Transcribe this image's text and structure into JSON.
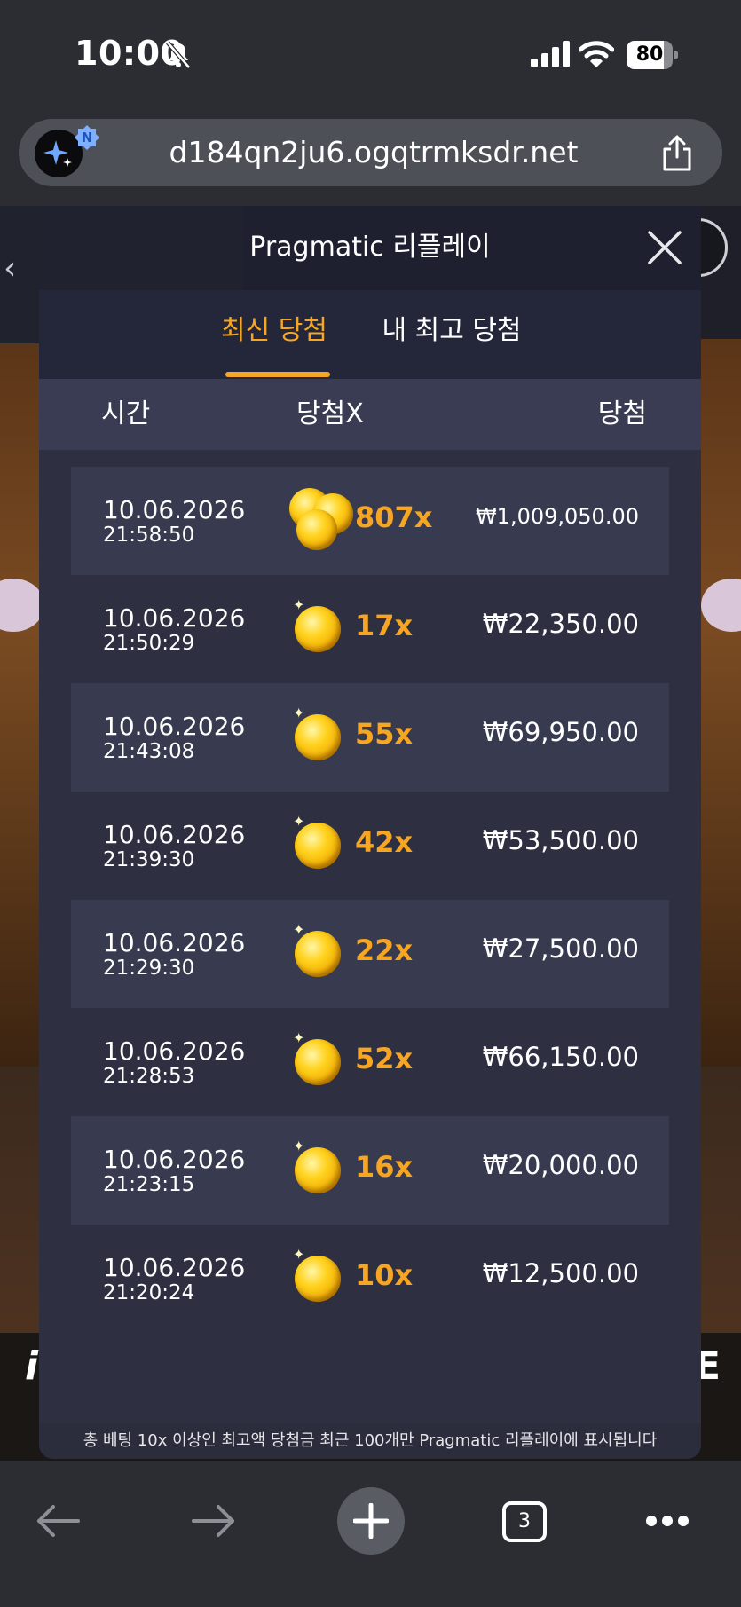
{
  "status_bar": {
    "time": "10:00",
    "battery_level": "80",
    "icons": [
      "bell-slash-icon",
      "cellular-signal-icon",
      "wifi-icon",
      "battery-icon"
    ]
  },
  "browser": {
    "url": "d184qn2ju6.ogqtrmksdr.net",
    "ai_badge": "N",
    "open_tabs": "3",
    "toolbar_icons": [
      "back-arrow-icon",
      "forward-arrow-icon",
      "plus-icon",
      "tabs-icon",
      "more-icon"
    ]
  },
  "modal": {
    "title": "Pragmatic 리플레이",
    "tabs": [
      {
        "label": "최신 당첨",
        "active": true
      },
      {
        "label": "내 최고 당첨",
        "active": false
      }
    ],
    "columns": {
      "time": "시간",
      "multiplier": "당첨X",
      "win": "당첨"
    },
    "rows": [
      {
        "date": "10.06.2026",
        "time": "21:58:50",
        "multiplier": "807x",
        "win": "₩1,009,050.00"
      },
      {
        "date": "10.06.2026",
        "time": "21:50:29",
        "multiplier": "17x",
        "win": "₩22,350.00"
      },
      {
        "date": "10.06.2026",
        "time": "21:43:08",
        "multiplier": "55x",
        "win": "₩69,950.00"
      },
      {
        "date": "10.06.2026",
        "time": "21:39:30",
        "multiplier": "42x",
        "win": "₩53,500.00"
      },
      {
        "date": "10.06.2026",
        "time": "21:29:30",
        "multiplier": "22x",
        "win": "₩27,500.00"
      },
      {
        "date": "10.06.2026",
        "time": "21:28:53",
        "multiplier": "52x",
        "win": "₩66,150.00"
      },
      {
        "date": "10.06.2026",
        "time": "21:23:15",
        "multiplier": "16x",
        "win": "₩20,000.00"
      },
      {
        "date": "10.06.2026",
        "time": "21:20:24",
        "multiplier": "10x",
        "win": "₩12,500.00"
      }
    ],
    "footer_note": "총 베팅 10x 이상인 최고액 당첨금 최근 100개만 Pragmatic 리플레이에 표시됩니다"
  },
  "colors": {
    "accent": "#f6a623",
    "modal_bg": "#2e3041",
    "row_stripe": "#383b4f"
  }
}
